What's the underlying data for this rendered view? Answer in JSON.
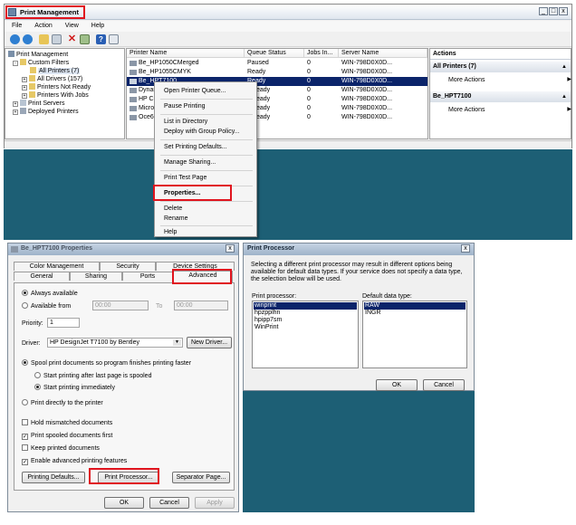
{
  "main_window": {
    "title": "Print Management",
    "menu": [
      "File",
      "Action",
      "View",
      "Help"
    ],
    "tree": [
      {
        "label": "Print Management",
        "indent": 0,
        "expander": ""
      },
      {
        "label": "Custom Filters",
        "indent": 1,
        "expander": "-"
      },
      {
        "label": "All Printers (7)",
        "indent": 2,
        "expander": ""
      },
      {
        "label": "All Drivers (157)",
        "indent": 2,
        "expander": "+"
      },
      {
        "label": "Printers Not Ready",
        "indent": 2,
        "expander": "+"
      },
      {
        "label": "Printers With Jobs",
        "indent": 2,
        "expander": "+"
      },
      {
        "label": "Print Servers",
        "indent": 1,
        "expander": "+"
      },
      {
        "label": "Deployed Printers",
        "indent": 1,
        "expander": "+"
      }
    ],
    "columns": [
      "Printer Name",
      "Queue Status",
      "Jobs In...",
      "Server Name"
    ],
    "rows": [
      {
        "name": "Be_HP1050CMerged",
        "status": "Paused",
        "jobs": "0",
        "server": "WIN-798D0X0D..."
      },
      {
        "name": "Be_HP1055CMYK",
        "status": "Ready",
        "jobs": "0",
        "server": "WIN-798D0X0D..."
      },
      {
        "name": "Be_HPT7100",
        "status": "Ready",
        "jobs": "0",
        "server": "WIN-798D0X0D..."
      },
      {
        "name": "Dynam",
        "status": "eady",
        "jobs": "0",
        "server": "WIN-798D0X0D..."
      },
      {
        "name": "HP Co",
        "status": "eady",
        "jobs": "0",
        "server": "WIN-798D0X0D..."
      },
      {
        "name": "Micros",
        "status": "eady",
        "jobs": "0",
        "server": "WIN-798D0X0D..."
      },
      {
        "name": "Oce6",
        "status": "eady",
        "jobs": "0",
        "server": "WIN-798D0X0D..."
      }
    ],
    "actions": {
      "header": "Actions",
      "group1": "All Printers (7)",
      "group1_item": "More Actions",
      "group2": "Be_HPT7100",
      "group2_item": "More Actions"
    }
  },
  "context_menu": {
    "items": [
      "Open Printer Queue...",
      "Pause Printing",
      "List in Directory",
      "Deploy with Group Policy...",
      "Set Printing Defaults...",
      "Manage Sharing...",
      "Print Test Page",
      "Properties...",
      "Delete",
      "Rename",
      "Help"
    ]
  },
  "properties_dialog": {
    "title": "Be_HPT7100 Properties",
    "tabs_row1": [
      "Color Management",
      "Security",
      "Device Settings"
    ],
    "tabs_row2": [
      "General",
      "Sharing",
      "Ports",
      "Advanced"
    ],
    "always_available": "Always available",
    "available_from": "Available from",
    "from_time": "00:00",
    "to_label": "To",
    "to_time": "00:00",
    "priority_label": "Priority:",
    "priority_value": "1",
    "driver_label": "Driver:",
    "driver_value": "HP DesignJet T7100 by Bentley",
    "new_driver": "New Driver...",
    "spool_option": "Spool print documents so program finishes printing faster",
    "spool_after_last": "Start printing after last page is spooled",
    "spool_immediately": "Start printing immediately",
    "print_direct": "Print directly to the printer",
    "hold_mismatched": "Hold mismatched documents",
    "spooled_first": "Print spooled documents first",
    "keep_printed": "Keep printed documents",
    "enable_advanced": "Enable advanced printing features",
    "printing_defaults": "Printing Defaults...",
    "print_processor": "Print Processor...",
    "separator_page": "Separator Page...",
    "ok": "OK",
    "cancel": "Cancel",
    "apply": "Apply"
  },
  "print_processor_dialog": {
    "title": "Print Processor",
    "description": "Selecting a different print processor may result in different options being available for default data types. If your service does not specify a data type, the selection below will be used.",
    "processor_label": "Print processor:",
    "processors": [
      "winprint",
      "hpzpplhn",
      "hpipp7sm",
      "WinPrint"
    ],
    "datatype_label": "Default data type:",
    "datatypes": [
      "RAW",
      "INGR"
    ],
    "ok": "OK",
    "cancel": "Cancel"
  },
  "colors": {
    "desktop": "#1d5f75",
    "selection": "#0b246a",
    "highlight_box": "#e0141e"
  }
}
